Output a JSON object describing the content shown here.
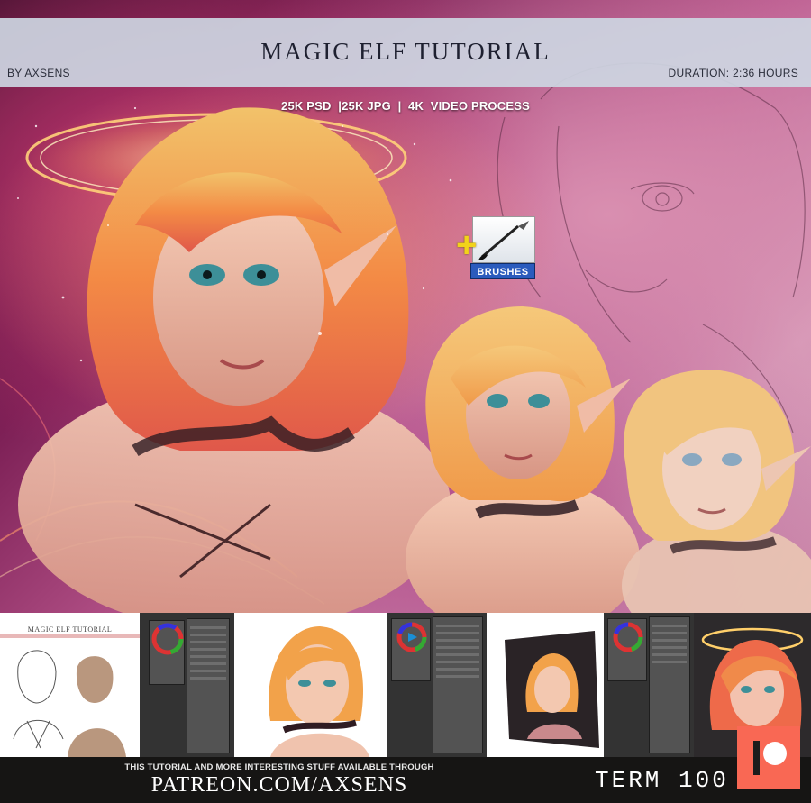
{
  "header": {
    "title": "MAGIC ELF TUTORIAL",
    "byline": "BY AXSENS",
    "duration": "DURATION: 2:36 HOURS",
    "formats": "25K PSD  |25K JPG  |  4K  VIDEO PROCESS"
  },
  "badge": {
    "plus_icon": "plus-icon",
    "brush_icon": "brush-icon",
    "label": "BRUSHES"
  },
  "strip": {
    "mini_title": "MAGIC ELF TUTORIAL"
  },
  "footer": {
    "line1": "THIS TUTORIAL AND MORE INTERESTING STUFF AVAILABLE THROUGH",
    "line2": "PATREON.COM/AXSENS",
    "term": "TERM 100",
    "logo_icon": "patreon-logo-icon"
  },
  "colors": {
    "patreon": "#f96854",
    "header_band": "#cdd6e2",
    "badge_blue": "#2a5bbd"
  }
}
